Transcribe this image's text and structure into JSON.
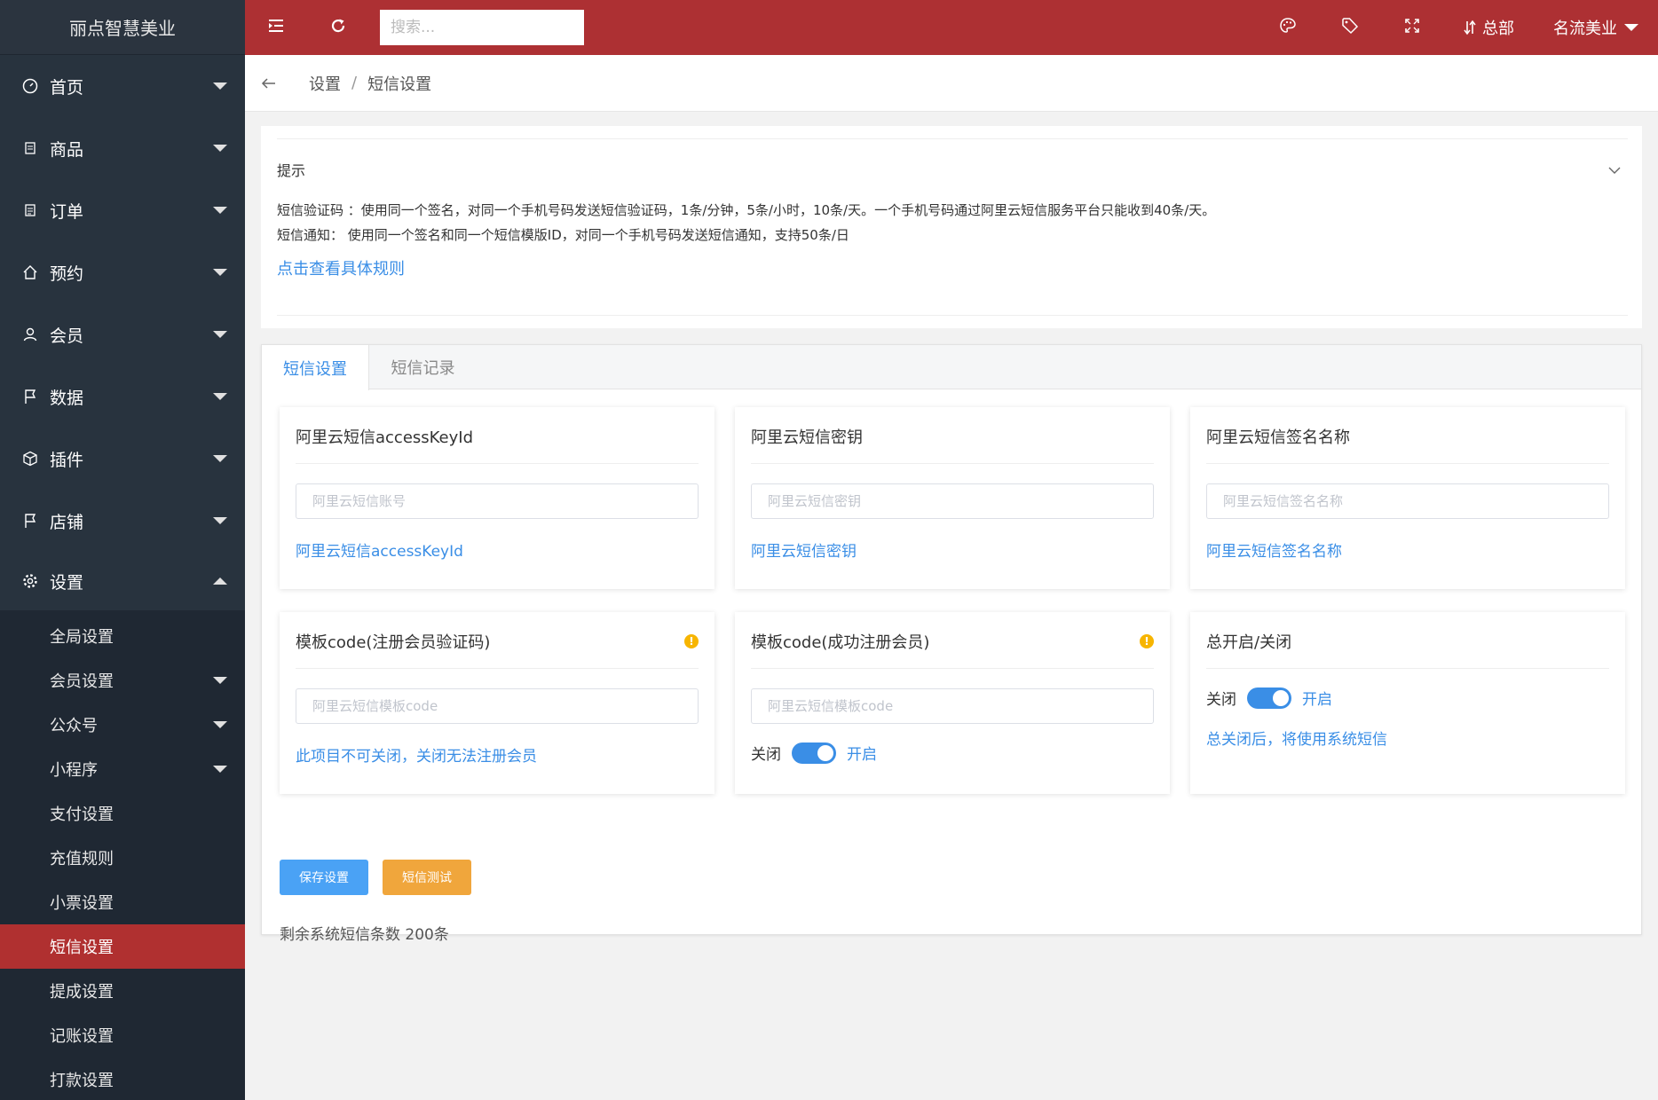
{
  "brand": "丽点智慧美业",
  "sidebar": {
    "items": [
      {
        "label": "首页",
        "icon": "dashboard-icon"
      },
      {
        "label": "商品",
        "icon": "document-icon"
      },
      {
        "label": "订单",
        "icon": "clipboard-icon"
      },
      {
        "label": "预约",
        "icon": "home-icon"
      },
      {
        "label": "会员",
        "icon": "user-icon"
      },
      {
        "label": "数据",
        "icon": "flag-icon"
      },
      {
        "label": "插件",
        "icon": "cube-icon"
      },
      {
        "label": "店铺",
        "icon": "flag-icon"
      },
      {
        "label": "设置",
        "icon": "gear-icon"
      }
    ],
    "sub_items": [
      {
        "label": "全局设置"
      },
      {
        "label": "会员设置"
      },
      {
        "label": "公众号"
      },
      {
        "label": "小程序"
      },
      {
        "label": "支付设置"
      },
      {
        "label": "充值规则"
      },
      {
        "label": "小票设置"
      },
      {
        "label": "短信设置"
      },
      {
        "label": "提成设置"
      },
      {
        "label": "记账设置"
      },
      {
        "label": "打款设置"
      }
    ]
  },
  "topbar": {
    "search_placeholder": "搜索...",
    "branch": "总部",
    "user": "名流美业"
  },
  "breadcrumb": {
    "level1": "设置",
    "separator": "/",
    "level2": "短信设置"
  },
  "tip": {
    "title": "提示",
    "line1": "短信验证码 ：使用同一个签名，对同一个手机号码发送短信验证码，1条/分钟，5条/小时，10条/天。一个手机号码通过阿里云短信服务平台只能收到40条/天。",
    "line2": "短信通知： 使用同一个签名和同一个短信模版ID，对同一个手机号码发送短信通知，支持50条/日",
    "link": "点击查看具体规则"
  },
  "tabs": {
    "settings": "短信设置",
    "records": "短信记录"
  },
  "cards": {
    "access_key": {
      "title": "阿里云短信accessKeyId",
      "placeholder": "阿里云短信账号",
      "hint": "阿里云短信accessKeyId"
    },
    "secret": {
      "title": "阿里云短信密钥",
      "placeholder": "阿里云短信密钥",
      "hint": "阿里云短信密钥"
    },
    "sign": {
      "title": "阿里云短信签名名称",
      "placeholder": "阿里云短信签名名称",
      "hint": "阿里云短信签名名称"
    },
    "tpl_verify": {
      "title": "模板code(注册会员验证码)",
      "placeholder": "阿里云短信模板code",
      "hint": "此项目不可关闭，关闭无法注册会员"
    },
    "tpl_success": {
      "title": "模板code(成功注册会员)",
      "placeholder": "阿里云短信模板code",
      "off": "关闭",
      "on": "开启"
    },
    "master": {
      "title": "总开启/关闭",
      "off": "关闭",
      "on": "开启",
      "hint": "总关闭后，将使用系统短信"
    }
  },
  "buttons": {
    "save": "保存设置",
    "test": "短信测试"
  },
  "remaining": "剩余系统短信条数 200条",
  "colors": {
    "topbar": "#ad3033",
    "sidebar": "#28333e",
    "active_item": "#b03030",
    "link": "#3a8ee6",
    "save_button": "#4aa2f5",
    "test_button": "#f0a63c"
  }
}
